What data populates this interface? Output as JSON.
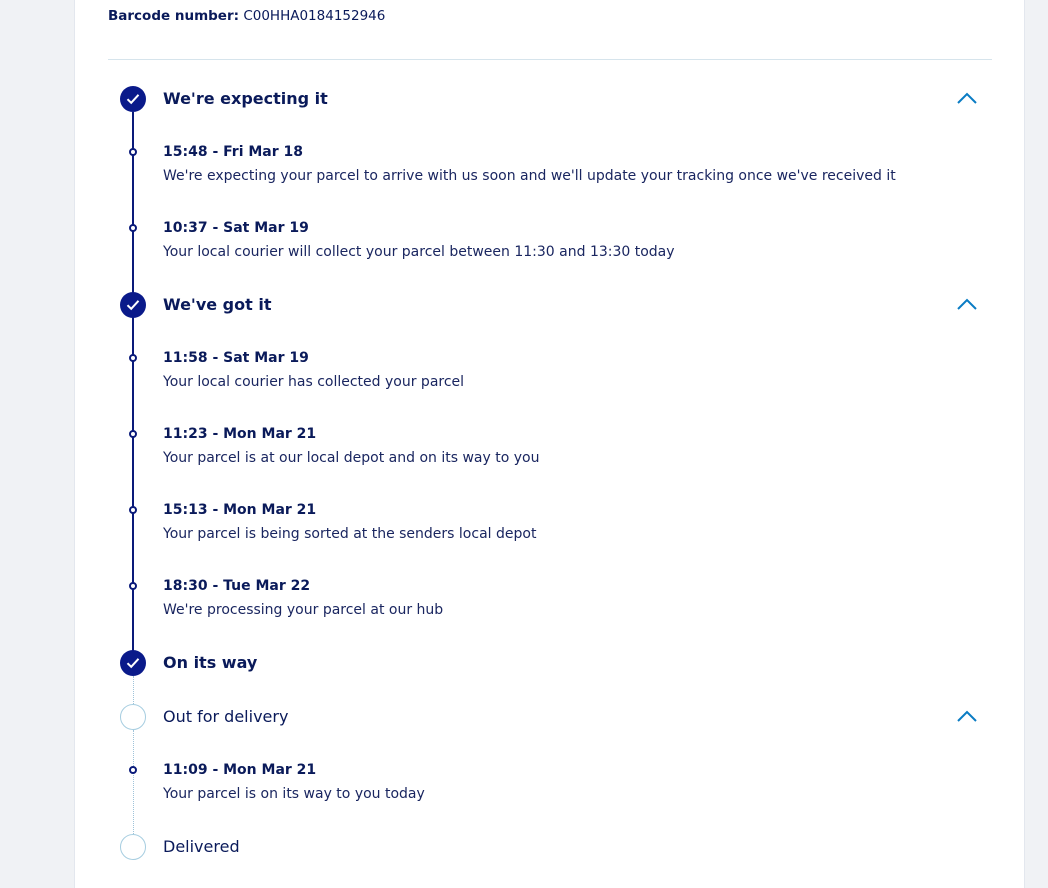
{
  "barcode": {
    "label": "Barcode number:",
    "value": "C00HHA0184152946"
  },
  "stages": [
    {
      "title": "We're expecting it",
      "status": "done",
      "expanded": true,
      "events": [
        {
          "time": "15:48 - Fri Mar 18",
          "description": "We're expecting your parcel to arrive with us soon and we'll update your tracking once we've received it"
        },
        {
          "time": "10:37 - Sat Mar 19",
          "description": "Your local courier will collect your parcel between 11:30 and 13:30 today"
        }
      ]
    },
    {
      "title": "We've got it",
      "status": "done",
      "expanded": true,
      "events": [
        {
          "time": "11:58 - Sat Mar 19",
          "description": "Your local courier has collected your parcel"
        },
        {
          "time": "11:23 - Mon Mar 21",
          "description": "Your parcel is at our local depot and on its way to you"
        },
        {
          "time": "15:13 - Mon Mar 21",
          "description": "Your parcel is being sorted at the senders local depot"
        },
        {
          "time": "18:30 - Tue Mar 22",
          "description": "We're processing your parcel at our hub"
        }
      ]
    },
    {
      "title": "On its way",
      "status": "done",
      "expanded": false,
      "events": []
    },
    {
      "title": "Out for delivery",
      "status": "pending",
      "expanded": true,
      "events": [
        {
          "time": "11:09 - Mon Mar 21",
          "description": "Your parcel is on its way to you today"
        }
      ]
    },
    {
      "title": "Delivered",
      "status": "pending",
      "expanded": false,
      "events": []
    }
  ],
  "icons": {
    "stage_done": "check-icon",
    "collapse": "chevron-up-icon"
  },
  "colors": {
    "brand_navy": "#0a1a8a",
    "accent_blue": "#0a7cc4",
    "pending_ring": "#a6cde0"
  }
}
